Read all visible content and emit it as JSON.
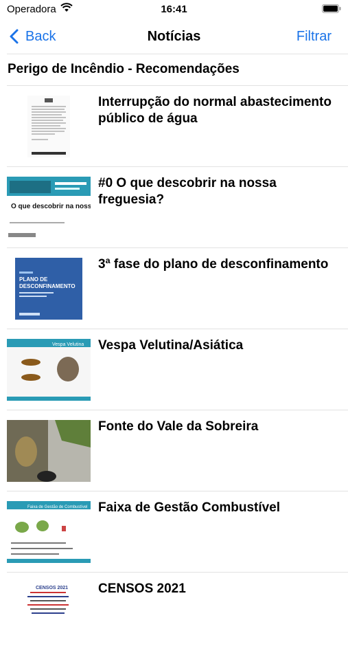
{
  "status_bar": {
    "carrier": "Operadora",
    "time": "16:41"
  },
  "nav": {
    "back_label": "Back",
    "title": "Notícias",
    "filter_label": "Filtrar"
  },
  "section_title": "Perigo de Incêndio - Recomendações",
  "items": [
    {
      "title": "Interrupção do normal abastecimento público de água"
    },
    {
      "title": "#0 O que descobrir na nossa freguesia?"
    },
    {
      "title": "3ª fase do plano de desconfinamento"
    },
    {
      "title": "Vespa Velutina/Asiática"
    },
    {
      "title": "Fonte do Vale da Sobreira"
    },
    {
      "title": "Faixa de Gestão Combustível"
    },
    {
      "title": "CENSOS 2021"
    }
  ],
  "thumb_texts": {
    "freguesia_caption": "O que descobrir na nossa freguesia?",
    "plano_caption_1": "PLANO DE",
    "plano_caption_2": "DESCONFINAMENTO",
    "vespa_caption": "Vespa Velutina",
    "faixa_caption": "Faixa de Gestão de Combustível",
    "censos_caption": "CENSOS 2021"
  },
  "colors": {
    "accent": "#1a73e8",
    "separator": "#e2e2e2"
  }
}
